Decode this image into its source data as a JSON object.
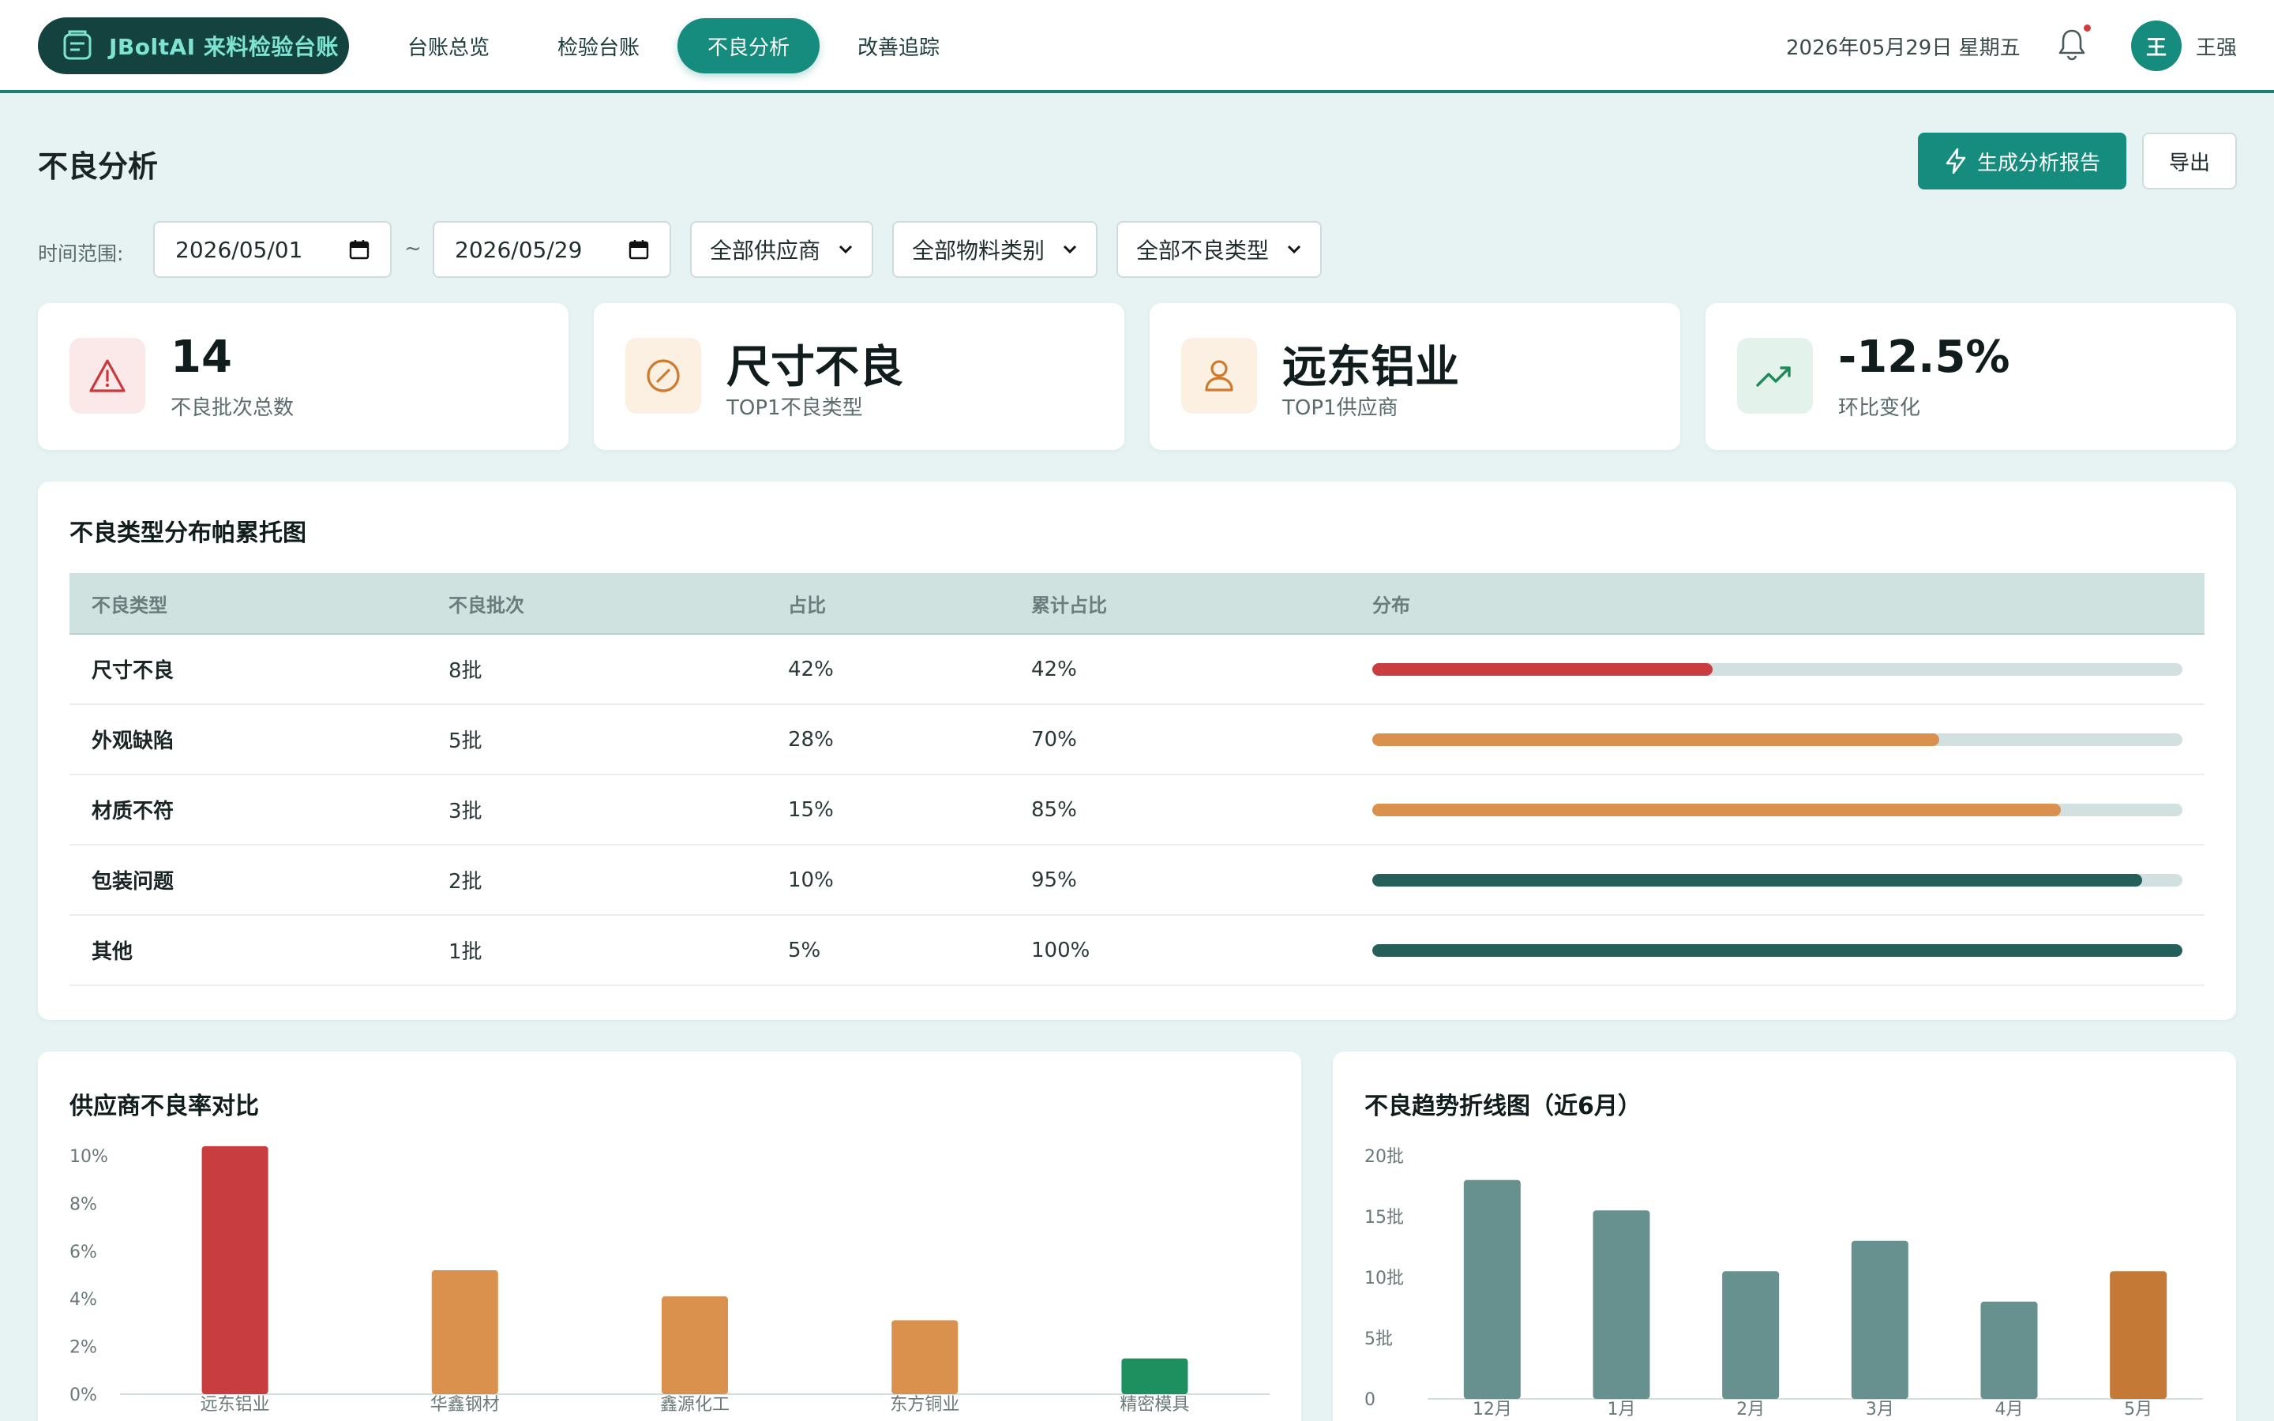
{
  "brand": {
    "name": "JBoltAI 来料检验台账"
  },
  "nav": {
    "items": [
      {
        "label": "台账总览",
        "active": false
      },
      {
        "label": "检验台账",
        "active": false
      },
      {
        "label": "不良分析",
        "active": true
      },
      {
        "label": "改善追踪",
        "active": false
      }
    ]
  },
  "header": {
    "date": "2026年05月29日 星期五",
    "user_initial": "王",
    "user_name": "王强"
  },
  "page": {
    "title": "不良分析",
    "generate_label": "生成分析报告",
    "export_label": "导出"
  },
  "filters": {
    "time_label": "时间范围:",
    "start_date": "2026/05/01",
    "separator": "~",
    "end_date": "2026/05/29",
    "supplier": "全部供应商",
    "material": "全部物料类别",
    "defect": "全部不良类型"
  },
  "kpis": [
    {
      "value": "14",
      "label": "不良批次总数",
      "icon": "warning-icon",
      "bg": "#fbe9e9",
      "color": "#c9393c"
    },
    {
      "value": "尺寸不良",
      "label": "TOP1不良类型",
      "icon": "compass-icon",
      "bg": "#fcf0e2",
      "color": "#cf7a2c"
    },
    {
      "value": "远东铝业",
      "label": "TOP1供应商",
      "icon": "user-icon",
      "bg": "#fcf0e2",
      "color": "#cf7a2c"
    },
    {
      "value": "-12.5%",
      "label": "环比变化",
      "icon": "trend-up-icon",
      "bg": "#e3f3ec",
      "color": "#1d8a5b"
    }
  ],
  "pareto": {
    "title": "不良类型分布帕累托图",
    "headers": [
      "不良类型",
      "不良批次",
      "占比",
      "累计占比",
      "分布"
    ],
    "rows": [
      {
        "type": "尺寸不良",
        "batches": "8批",
        "share": "42%",
        "cumulative": "42%",
        "fill": 0.42,
        "color": "#c83d3f"
      },
      {
        "type": "外观缺陷",
        "batches": "5批",
        "share": "28%",
        "cumulative": "70%",
        "fill": 0.7,
        "color": "#db914e"
      },
      {
        "type": "材质不符",
        "batches": "3批",
        "share": "15%",
        "cumulative": "85%",
        "fill": 0.85,
        "color": "#db914e"
      },
      {
        "type": "包装问题",
        "batches": "2批",
        "share": "10%",
        "cumulative": "95%",
        "fill": 0.95,
        "color": "#245f5a"
      },
      {
        "type": "其他",
        "batches": "1批",
        "share": "5%",
        "cumulative": "100%",
        "fill": 1.0,
        "color": "#245f5a"
      }
    ]
  },
  "chart_data": [
    {
      "type": "bar",
      "title": "供应商不良率对比",
      "categories": [
        "远东铝业",
        "华鑫钢材",
        "鑫源化工",
        "东方铜业",
        "精密模具"
      ],
      "values": [
        10.4,
        5.2,
        4.1,
        3.1,
        1.5
      ],
      "colors": [
        "#c83d3f",
        "#db914e",
        "#db914e",
        "#db914e",
        "#1e8f5e"
      ],
      "yticks": [
        "0%",
        "2%",
        "4%",
        "6%",
        "8%",
        "10%"
      ],
      "ylim": [
        0,
        10
      ]
    },
    {
      "type": "bar",
      "title": "不良趋势折线图（近6月）",
      "categories": [
        "12月",
        "1月",
        "2月",
        "3月",
        "4月",
        "5月"
      ],
      "values": [
        18,
        15.5,
        10.5,
        13,
        8,
        10.5
      ],
      "colors": [
        "#67918f",
        "#67918f",
        "#67918f",
        "#67918f",
        "#67918f",
        "#c47a36"
      ],
      "yticks": [
        "0",
        "5批",
        "10批",
        "15批",
        "20批"
      ],
      "ylim": [
        0,
        20
      ]
    }
  ]
}
